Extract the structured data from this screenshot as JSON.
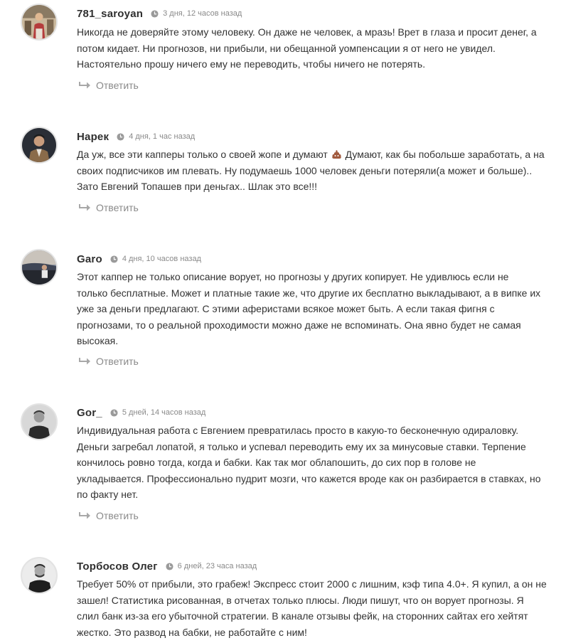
{
  "comments": [
    {
      "author": "781_saroyan",
      "date": "3 дня, 12 часов назад",
      "text_lines": [
        "Никогда не доверяйте этому человеку. Он даже не человек, а мразь! Врет в глаза и просит денег, а",
        "потом кидает. Ни прогнозов, ни прибыли, ни обещанной уомпенсации я от него не увидел.",
        "Настоятельно прошу ничего ему не переводить, чтобы ничего не потерять."
      ],
      "reply_label": "Ответить",
      "avatar_icon": "user-avatar-photo"
    },
    {
      "author": "Нарек",
      "date": "4 дня, 1 час назад",
      "text_lines": [
        "Да уж, все эти капперы только о своей жопе и думают",
        "Думают, как бы побольше заработать, а на",
        "своих подписчиков им плевать. Ну подумаешь 1000 человек деньги потеряли(а может и больше)..",
        "Зато Евгений Топашев при деньгах.. Шлак это все!!!"
      ],
      "emoji_icon": "pile-of-poo-emoji",
      "reply_label": "Ответить",
      "avatar_icon": "user-avatar-photo"
    },
    {
      "author": "Garo",
      "date": "4 дня, 10 часов назад",
      "text_lines": [
        "Этот каппер не только описание ворует, но прогнозы у других копирует. Не удивлюсь если не",
        "только бесплатные. Может и платные такие же, что другие их бесплатно выкладывают, а в випке их",
        "уже за деньги предлагают. С этими аферистами всякое может быть. А если такая фигня с",
        "прогнозами, то о реальной проходимости можно даже не вспоминать. Она явно будет не самая",
        "высокая."
      ],
      "reply_label": "Ответить",
      "avatar_icon": "user-avatar-photo"
    },
    {
      "author": "Gor_",
      "date": "5 дней, 14 часов назад",
      "text_lines": [
        "Индивидуальная работа с Евгением превратилась просто в какую-то бесконечную одираловку.",
        "Деньги загребал лопатой, я только и успевал переводить ему их за минусовые ставки. Терпение",
        "кончилось ровно тогда, когда и бабки. Как так мог облапошить, до сих пор в голове не",
        "укладывается. Профессионально пудрит мозги, что кажется вроде как он разбирается в ставках, но",
        "по факту нет."
      ],
      "reply_label": "Ответить",
      "avatar_icon": "user-avatar-photo"
    },
    {
      "author": "Торбосов Олег",
      "date": "6 дней, 23 часа назад",
      "text_lines": [
        "Требует 50% от прибыли, это грабеж! Экспресс стоит 2000 с лишним, кэф типа 4.0+. Я купил, а он не",
        "зашел! Статистика рисованная, в отчетах только плюсы. Люди пишут, что он ворует прогнозы. Я",
        "слил банк из-за его убыточной стратегии. В канале отзывы фейк, на сторонних сайтах его хейтят",
        "жестко. Это развод на бабки, не работайте с ним!"
      ],
      "avatar_icon": "user-avatar-photo"
    }
  ],
  "colors": {
    "text": "#333333",
    "author": "#2f2f2f",
    "muted": "#8a8a8a",
    "avatar_border": "#e3e3e3"
  },
  "icons": {
    "clock": "clock-icon",
    "reply": "reply-arrow-icon"
  }
}
